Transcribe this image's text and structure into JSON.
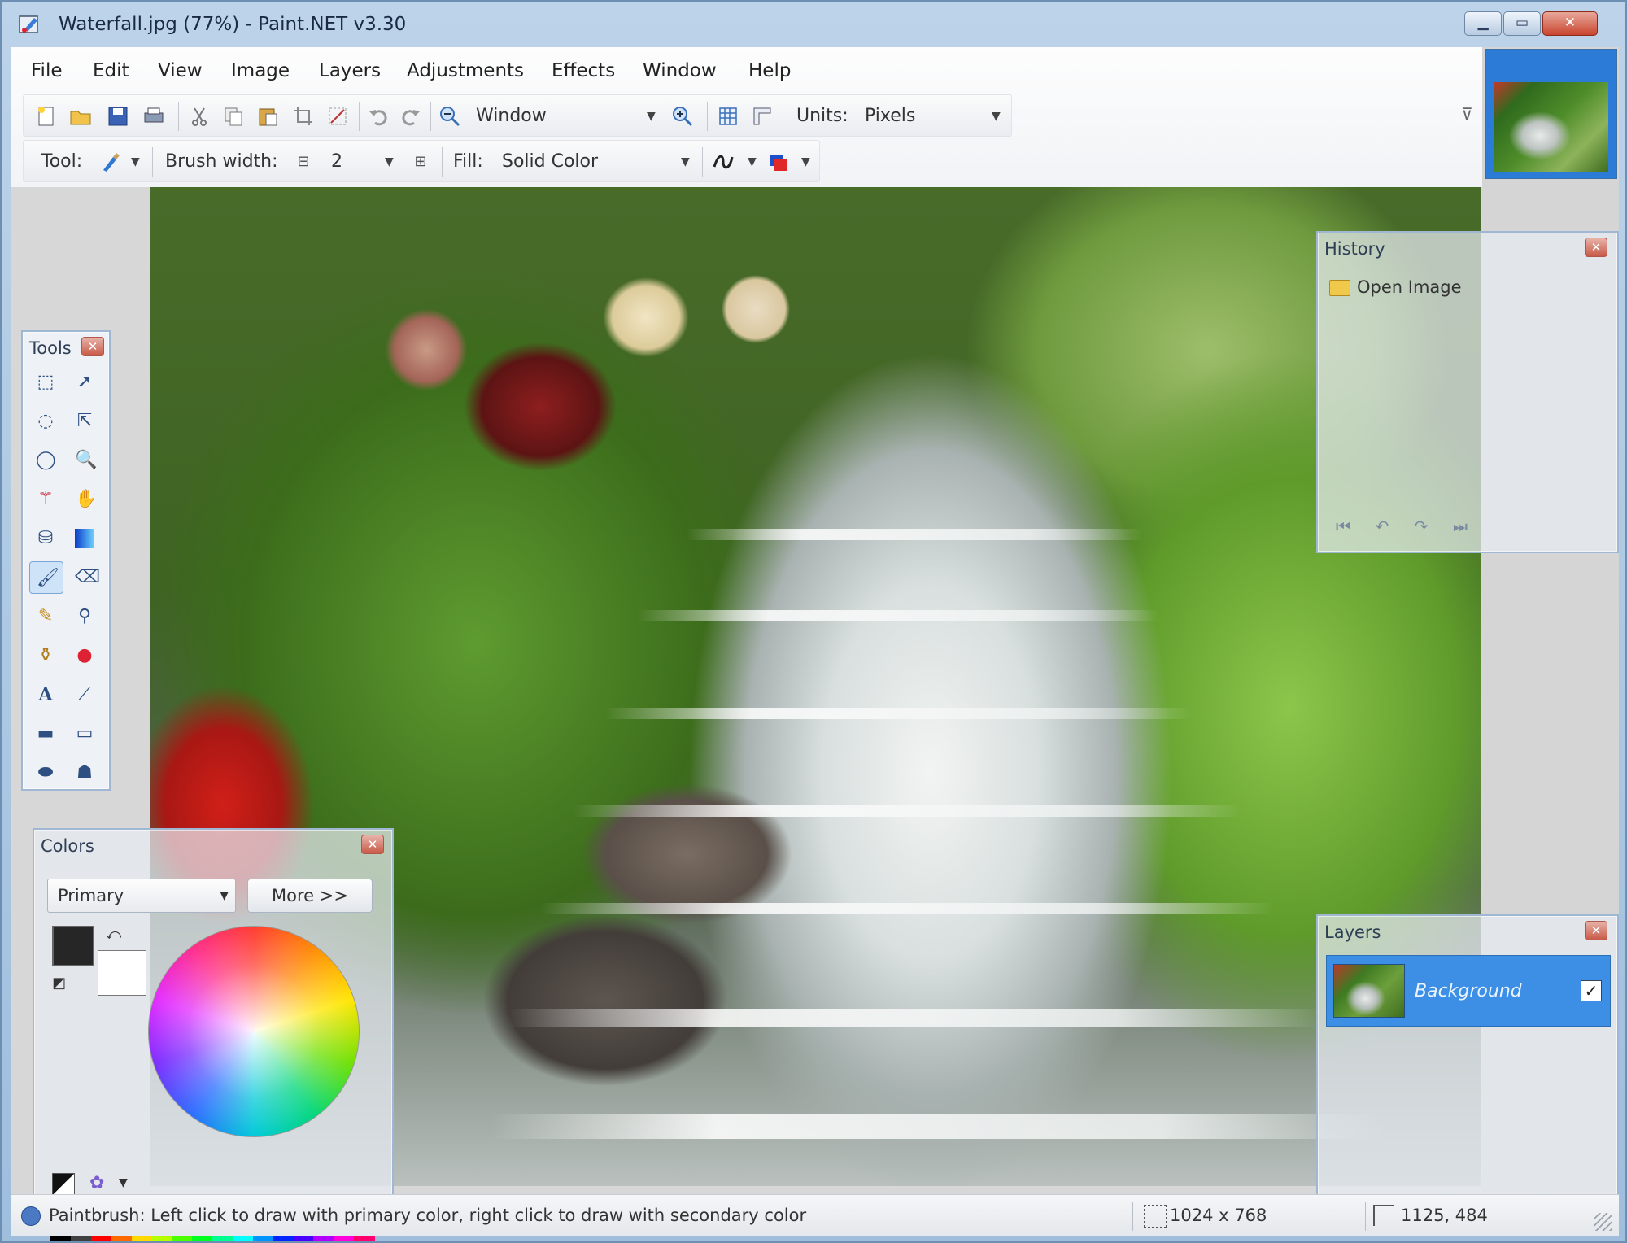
{
  "window": {
    "title": "Waterfall.jpg (77%) - Paint.NET v3.30"
  },
  "menu": [
    "File",
    "Edit",
    "View",
    "Image",
    "Layers",
    "Adjustments",
    "Effects",
    "Window",
    "Help"
  ],
  "toolbar1": {
    "zoom_value": "Window",
    "units_label": "Units:",
    "units_value": "Pixels"
  },
  "toolbar2": {
    "tool_label": "Tool:",
    "brush_width_label": "Brush width:",
    "brush_width_value": "2",
    "fill_label": "Fill:",
    "fill_value": "Solid Color"
  },
  "panels": {
    "tools": {
      "title": "Tools"
    },
    "history": {
      "title": "History",
      "items": [
        "Open Image"
      ]
    },
    "colors": {
      "title": "Colors",
      "mode": "Primary",
      "more_label": "More >>",
      "primary_color": "#262626",
      "secondary_color": "#ffffff",
      "palette": [
        "#000000",
        "#404040",
        "#ff0000",
        "#ff6a00",
        "#ffd800",
        "#b6ff00",
        "#4cff00",
        "#00ff21",
        "#00ff90",
        "#00ffff",
        "#0094ff",
        "#0026ff",
        "#4800ff",
        "#b200ff",
        "#ff00dc",
        "#ff006e"
      ]
    },
    "layers": {
      "title": "Layers",
      "items": [
        {
          "name": "Background",
          "visible": true
        }
      ]
    }
  },
  "statusbar": {
    "hint": "Paintbrush: Left click to draw with primary color, right click to draw with secondary color",
    "image_size": "1024 x 768",
    "cursor_pos": "1125, 484"
  },
  "icons": {
    "caption": [
      "minimize-icon",
      "maximize-icon",
      "close-icon"
    ]
  }
}
